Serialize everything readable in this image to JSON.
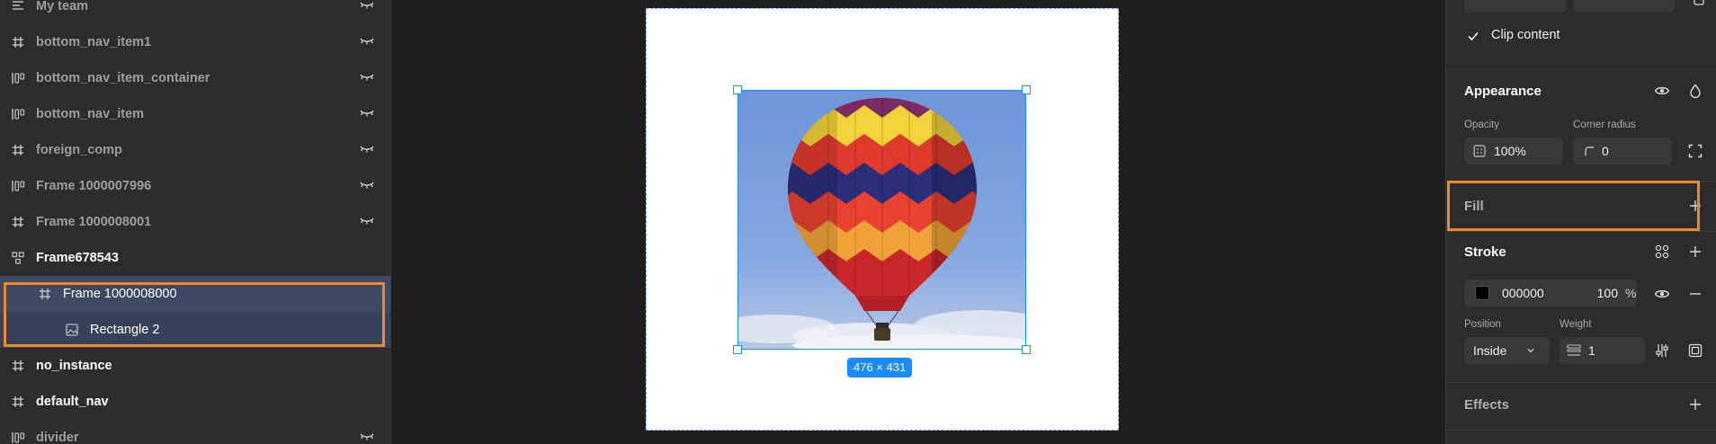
{
  "layers": [
    {
      "label": "My team",
      "icon": "text-align-icon",
      "bold": false,
      "eye": true
    },
    {
      "label": "bottom_nav_item1",
      "icon": "frame-hash-icon",
      "bold": false,
      "eye": true
    },
    {
      "label": "bottom_nav_item_container",
      "icon": "auto-layout-icon",
      "bold": false,
      "eye": true
    },
    {
      "label": "bottom_nav_item",
      "icon": "auto-layout-icon",
      "bold": false,
      "eye": true
    },
    {
      "label": "foreign_comp",
      "icon": "frame-hash-icon",
      "bold": false,
      "eye": true
    },
    {
      "label": "Frame 1000007996",
      "icon": "auto-layout-icon",
      "bold": false,
      "eye": true
    },
    {
      "label": "Frame 1000008001",
      "icon": "frame-hash-icon",
      "bold": false,
      "eye": true
    },
    {
      "label": "Frame678543",
      "icon": "component-icon",
      "bold": true,
      "eye": false
    },
    {
      "label": "Frame 1000008000",
      "icon": "frame-hash-icon",
      "bold": false,
      "eye": false,
      "selected": true,
      "indent": 1
    },
    {
      "label": "Rectangle 2",
      "icon": "image-icon",
      "bold": false,
      "eye": false,
      "selected": true,
      "indent": 2
    },
    {
      "label": "no_instance",
      "icon": "frame-hash-icon",
      "bold": true,
      "eye": false
    },
    {
      "label": "default_nav",
      "icon": "frame-hash-icon",
      "bold": true,
      "eye": false
    },
    {
      "label": "divider",
      "icon": "auto-layout-icon",
      "bold": false,
      "eye": true
    }
  ],
  "canvas": {
    "size_badge": "476 × 431",
    "image": "hot-air-balloon-photo"
  },
  "props": {
    "clip_content": {
      "label": "Clip content",
      "checked": true
    },
    "appearance": {
      "title": "Appearance",
      "opacity_label": "Opacity",
      "opacity_value": "100%",
      "corner_radius_label": "Corner radius",
      "corner_radius_value": "0"
    },
    "fill": {
      "title": "Fill"
    },
    "stroke": {
      "title": "Stroke",
      "color_hex": "000000",
      "swatch": "#000000",
      "opacity": "100",
      "percent": "%",
      "position_label": "Position",
      "position_value": "Inside",
      "weight_label": "Weight",
      "weight_value": "1"
    },
    "effects": {
      "title": "Effects"
    }
  },
  "colors": {
    "accent": "#1a8cff",
    "highlight": "#f0892e",
    "panel": "#2c2c2c",
    "canvas": "#1e1e1e",
    "selection": "#3e4a63"
  }
}
